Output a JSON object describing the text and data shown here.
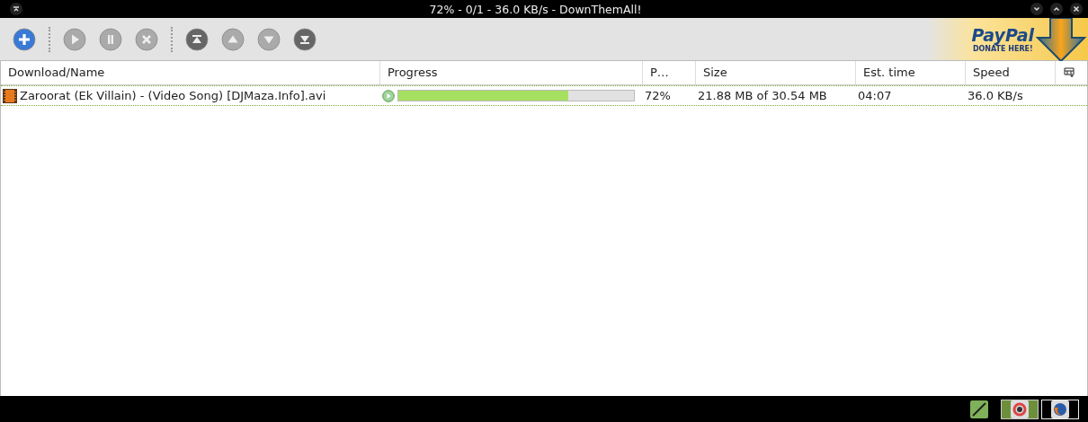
{
  "window": {
    "title": "72% - 0/1 - 36.0 KB/s - DownThemAll!"
  },
  "toolbar": [
    {
      "kind": "add",
      "disabled": false
    },
    {
      "kind": "separator"
    },
    {
      "kind": "start",
      "disabled": true
    },
    {
      "kind": "pause",
      "disabled": true
    },
    {
      "kind": "cancel",
      "disabled": true
    },
    {
      "kind": "separator"
    },
    {
      "kind": "top",
      "disabled": false
    },
    {
      "kind": "up",
      "disabled": true
    },
    {
      "kind": "down",
      "disabled": true
    },
    {
      "kind": "bottom",
      "disabled": false
    }
  ],
  "donate": {
    "brand": "PayPal",
    "caption": "DONATE HERE!"
  },
  "table": {
    "columns": [
      "Download/Name",
      "Progress",
      "P…",
      "Size",
      "Est. time",
      "Speed"
    ],
    "rows": [
      {
        "name": "Zaroorat (Ek Villain) - (Video Song) [DJMaza.Info].avi",
        "level": 0.72,
        "percent": "72%",
        "size": "21.88 MB of 30.54 MB",
        "time": "04:07",
        "speed": "36.0 KB/s",
        "selected": true
      }
    ]
  },
  "taskbar": [
    {
      "kind": "pen",
      "selected": false,
      "highlighted": false
    },
    {
      "kind": "color-wheel",
      "selected": true,
      "highlighted": false
    },
    {
      "kind": "browser",
      "selected": false,
      "highlighted": true
    }
  ]
}
